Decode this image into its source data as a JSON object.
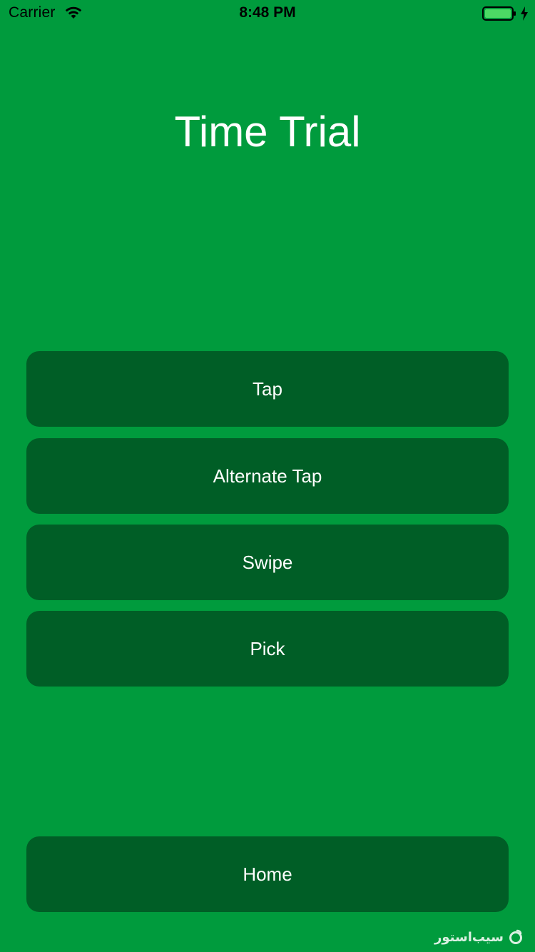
{
  "status_bar": {
    "carrier": "Carrier",
    "time": "8:48 PM",
    "wifi_icon": "wifi-icon",
    "battery_icon": "battery-full-icon",
    "charging_icon": "charging-bolt-icon"
  },
  "title": "Time Trial",
  "buttons": {
    "tap": "Tap",
    "alternate_tap": "Alternate Tap",
    "swipe": "Swipe",
    "pick": "Pick",
    "home": "Home"
  },
  "watermark": {
    "text": "سیب‌استور"
  },
  "colors": {
    "background": "#009b3d",
    "button": "#005e26",
    "text": "#ffffff",
    "battery": "#4cd964"
  }
}
